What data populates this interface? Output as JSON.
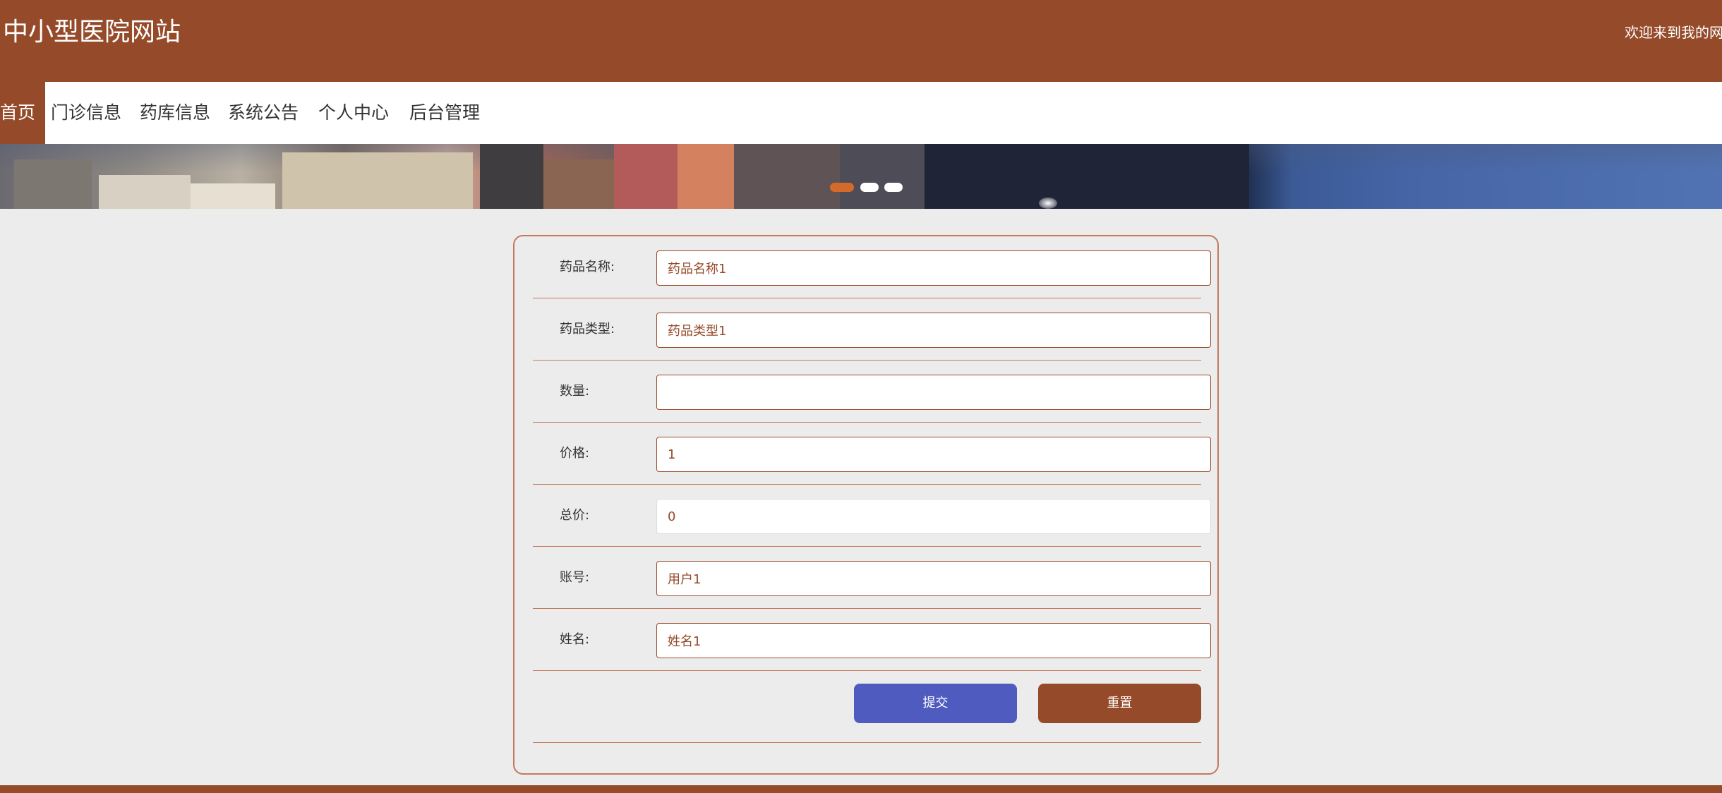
{
  "header": {
    "site_title": "中小型医院网站",
    "welcome_text": "欢迎来到我的网"
  },
  "nav": {
    "items": [
      {
        "label": "首页",
        "active": true
      },
      {
        "label": "门诊信息"
      },
      {
        "label": "药库信息"
      },
      {
        "label": "系统公告"
      },
      {
        "label": "个人中心"
      },
      {
        "label": "后台管理"
      }
    ]
  },
  "banner": {
    "slide_count": 3,
    "active_slide": 1
  },
  "form": {
    "fields": [
      {
        "label": "药品名称:",
        "value": "药品名称1"
      },
      {
        "label": "药品类型:",
        "value": "药品类型1"
      },
      {
        "label": "数量:",
        "value": ""
      },
      {
        "label": "价格:",
        "value": "1"
      },
      {
        "label": "总价:",
        "value": "0",
        "readonly": true
      },
      {
        "label": "账号:",
        "value": "用户1"
      },
      {
        "label": "姓名:",
        "value": "姓名1"
      }
    ],
    "submit_label": "提交",
    "reset_label": "重置"
  },
  "colors": {
    "brand": "#954a29",
    "submit": "#4f5bbf",
    "page_bg": "#ececec"
  }
}
